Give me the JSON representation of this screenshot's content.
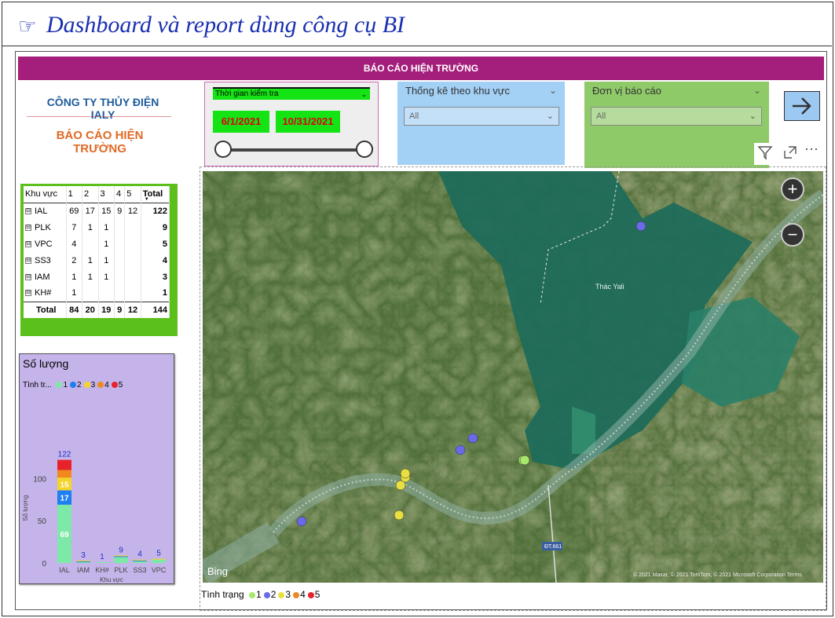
{
  "slide": {
    "hand_icon": "☞",
    "title": "Dashboard và report dùng công cụ BI"
  },
  "report": {
    "banner": "BÁO CÁO HIỆN TRƯỜNG",
    "company": "CÔNG TY THỦY ĐIỆN IALY",
    "title": "BÁO CÁO HIỆN TRƯỜNG"
  },
  "matrix": {
    "headers": [
      "Khu vực",
      "1",
      "2",
      "3",
      "4",
      "5",
      "Total"
    ],
    "expand_icon": "⊟",
    "rows": [
      {
        "area": "IAL",
        "c1": "69",
        "c2": "17",
        "c3": "15",
        "c4": "9",
        "c5": "12",
        "total": "122"
      },
      {
        "area": "PLK",
        "c1": "7",
        "c2": "1",
        "c3": "1",
        "c4": "",
        "c5": "",
        "total": "9"
      },
      {
        "area": "VPC",
        "c1": "4",
        "c2": "",
        "c3": "1",
        "c4": "",
        "c5": "",
        "total": "5"
      },
      {
        "area": "SS3",
        "c1": "2",
        "c2": "1",
        "c3": "1",
        "c4": "",
        "c5": "",
        "total": "4"
      },
      {
        "area": "IAM",
        "c1": "1",
        "c2": "1",
        "c3": "1",
        "c4": "",
        "c5": "",
        "total": "3"
      },
      {
        "area": "KH#",
        "c1": "1",
        "c2": "",
        "c3": "",
        "c4": "",
        "c5": "",
        "total": "1"
      }
    ],
    "total": {
      "label": "Total",
      "c1": "84",
      "c2": "20",
      "c3": "19",
      "c4": "9",
      "c5": "12",
      "total": "144"
    }
  },
  "chart_data": {
    "type": "bar",
    "title": "Số lượng",
    "legend_title": "Tình tr...",
    "xlabel": "Khu vực",
    "ylabel": "Số lượng",
    "categories": [
      "IAL",
      "IAM",
      "KH#",
      "PLK",
      "SS3",
      "VPC"
    ],
    "totals": [
      122,
      3,
      1,
      9,
      4,
      5
    ],
    "series": [
      {
        "name": "1",
        "color": "#7ee8a8",
        "values": [
          69,
          1,
          1,
          7,
          2,
          4
        ]
      },
      {
        "name": "2",
        "color": "#1e7ff0",
        "values": [
          17,
          1,
          0,
          1,
          1,
          0
        ]
      },
      {
        "name": "3",
        "color": "#f5d42a",
        "values": [
          15,
          1,
          0,
          1,
          1,
          1
        ]
      },
      {
        "name": "4",
        "color": "#f08a1c",
        "values": [
          9,
          0,
          0,
          0,
          0,
          0
        ]
      },
      {
        "name": "5",
        "color": "#e8222b",
        "values": [
          12,
          0,
          0,
          0,
          0,
          0
        ]
      }
    ],
    "yticks": [
      0,
      50,
      100
    ],
    "ylim": [
      0,
      140
    ],
    "grid": false,
    "legend_position": "top-left"
  },
  "slicers": {
    "time": {
      "label": "Thời gian kiểm tra",
      "start": "6/1/2021",
      "end": "10/31/2021"
    },
    "area": {
      "label": "Thống kê theo khu vực",
      "value": "All"
    },
    "unit": {
      "label": "Đơn vị báo cáo",
      "value": "All"
    }
  },
  "map": {
    "place_label": "Thác Yali",
    "road_label": "ĐT.661",
    "provider": "Bing",
    "copyright": "© 2021 Maxar, © 2021 TomTom, © 2021 Microsoft Corporation  Terms",
    "zoom_in": "+",
    "zoom_out": "−",
    "legend_title": "Tình trạng",
    "legend": [
      {
        "name": "1",
        "color": "#a8e86a"
      },
      {
        "name": "2",
        "color": "#6a6ae8"
      },
      {
        "name": "3",
        "color": "#e8e040"
      },
      {
        "name": "4",
        "color": "#e88a2a"
      },
      {
        "name": "5",
        "color": "#e8222b"
      }
    ],
    "points": [
      {
        "status": "2",
        "color": "#6a6ae8"
      },
      {
        "status": "2",
        "color": "#6a6ae8"
      },
      {
        "status": "1",
        "color": "#a8e86a"
      },
      {
        "status": "2",
        "color": "#6a6ae8"
      },
      {
        "status": "1",
        "color": "#a8e86a"
      },
      {
        "status": "3",
        "color": "#e8e040"
      },
      {
        "status": "3",
        "color": "#e8e040"
      },
      {
        "status": "3",
        "color": "#e8e040"
      },
      {
        "status": "3",
        "color": "#e8e040"
      },
      {
        "status": "2",
        "color": "#6a6ae8"
      }
    ]
  },
  "toolbar": {
    "filter_icon": "filter-icon",
    "focus_icon": "focus-mode-icon",
    "more_label": "⋯"
  }
}
